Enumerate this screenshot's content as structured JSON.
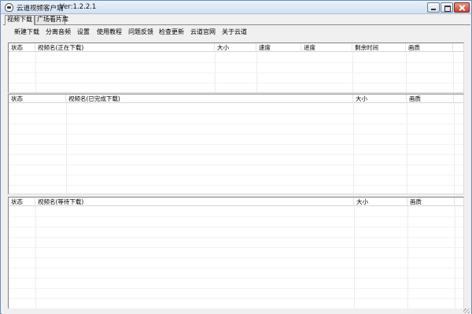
{
  "window": {
    "title": "云道视频客户端",
    "version": "Ver:1.2.2.1",
    "icon": "app-logo-icon"
  },
  "tabs": [
    {
      "label": "视频下载",
      "active": true
    },
    {
      "label": "广场看片库",
      "active": false
    }
  ],
  "menu": [
    {
      "label": "新建下载"
    },
    {
      "label": "分离音频"
    },
    {
      "label": "设置"
    },
    {
      "label": "使用教程"
    },
    {
      "label": "问题反馈"
    },
    {
      "label": "检查更新"
    },
    {
      "label": "云道官网"
    },
    {
      "label": "关于云道"
    }
  ],
  "downloading": {
    "columns": [
      "状态",
      "视频名(正在下载)",
      "大小",
      "速度",
      "进度",
      "剩余时间",
      "画质"
    ],
    "rows": []
  },
  "completed": {
    "columns": [
      "状态",
      "视频名(已完成下载)",
      "大小",
      "画质"
    ],
    "rows": []
  },
  "waiting": {
    "columns": [
      "状态",
      "视频名(等待下载)",
      "大小",
      "画质"
    ],
    "rows": []
  }
}
